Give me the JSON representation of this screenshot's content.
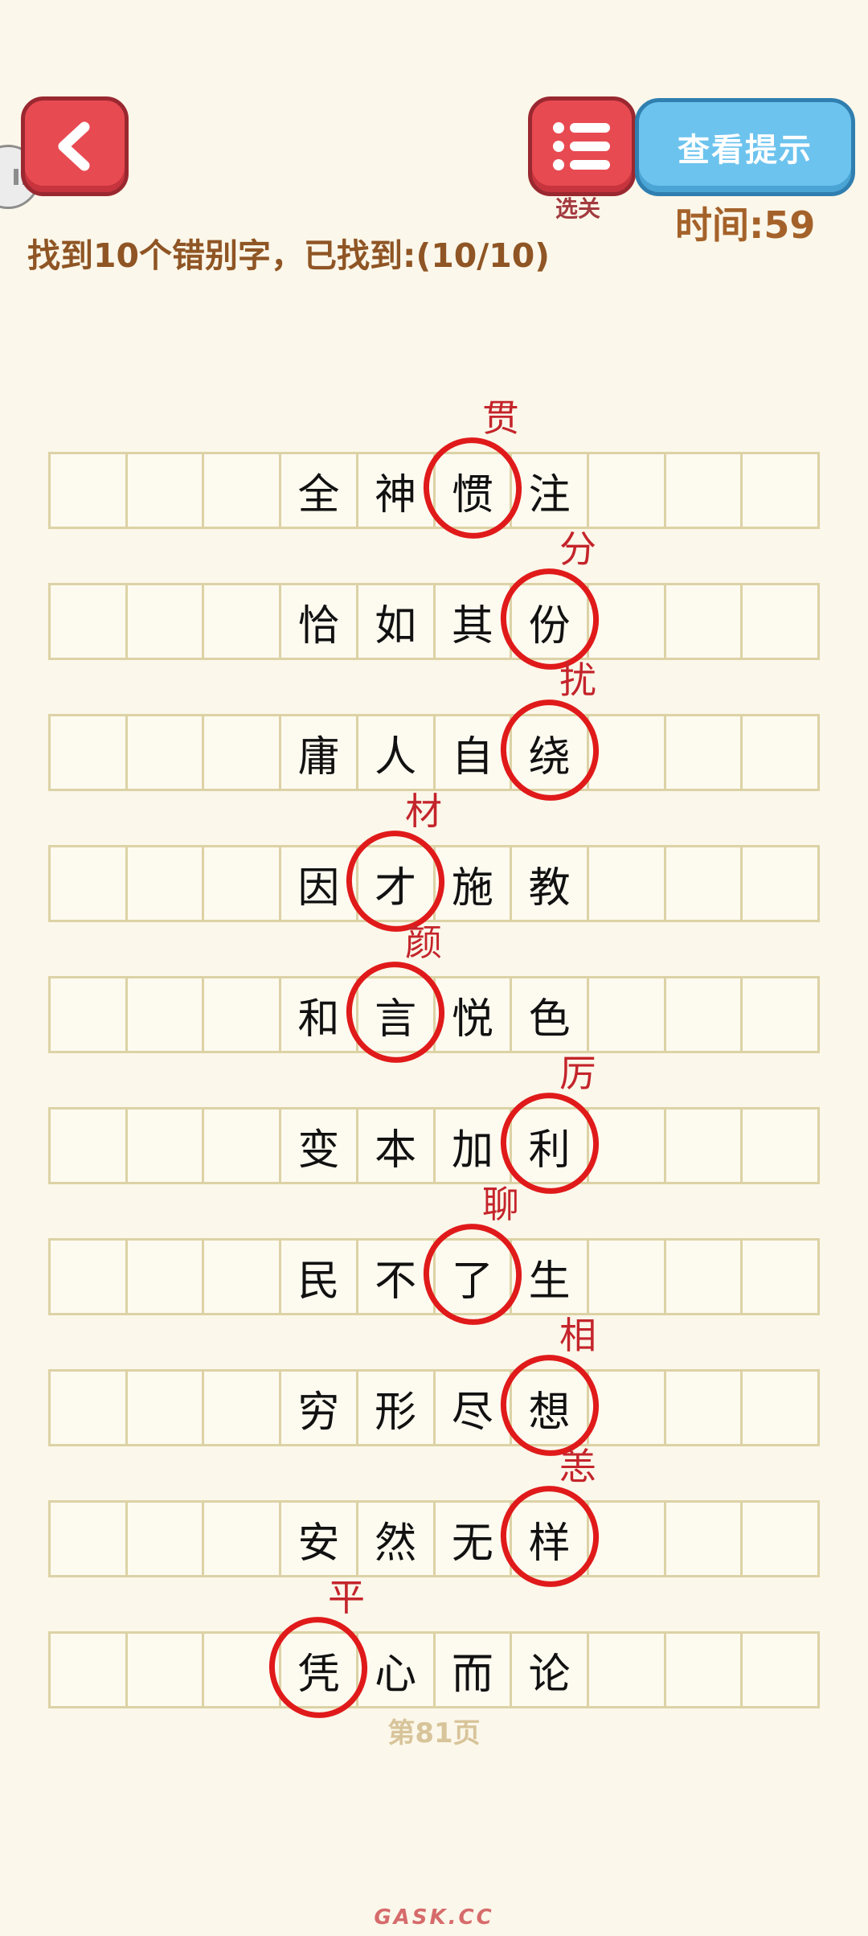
{
  "header": {
    "back_icon": "chevron-left-icon",
    "menu_icon": "list-icon",
    "menu_label": "选关",
    "hint_label": "查看提示",
    "timer": "时间:59",
    "status": "找到10个错别字，已找到:(10/10)"
  },
  "colors": {
    "mark": "#e01a1a",
    "correction": "#c4242b",
    "grid": "#dcd2a5",
    "background": "#fbf7ea"
  },
  "rows": [
    {
      "chars": [
        "",
        "",
        "",
        "全",
        "神",
        "惯",
        "注",
        "",
        "",
        ""
      ],
      "wrong_index": 5,
      "correction": "贯"
    },
    {
      "chars": [
        "",
        "",
        "",
        "恰",
        "如",
        "其",
        "份",
        "",
        "",
        ""
      ],
      "wrong_index": 6,
      "correction": "分"
    },
    {
      "chars": [
        "",
        "",
        "",
        "庸",
        "人",
        "自",
        "绕",
        "",
        "",
        ""
      ],
      "wrong_index": 6,
      "correction": "扰"
    },
    {
      "chars": [
        "",
        "",
        "",
        "因",
        "才",
        "施",
        "教",
        "",
        "",
        ""
      ],
      "wrong_index": 4,
      "correction": "材"
    },
    {
      "chars": [
        "",
        "",
        "",
        "和",
        "言",
        "悦",
        "色",
        "",
        "",
        ""
      ],
      "wrong_index": 4,
      "correction": "颜"
    },
    {
      "chars": [
        "",
        "",
        "",
        "变",
        "本",
        "加",
        "利",
        "",
        "",
        ""
      ],
      "wrong_index": 6,
      "correction": "厉"
    },
    {
      "chars": [
        "",
        "",
        "",
        "民",
        "不",
        "了",
        "生",
        "",
        "",
        ""
      ],
      "wrong_index": 5,
      "correction": "聊"
    },
    {
      "chars": [
        "",
        "",
        "",
        "穷",
        "形",
        "尽",
        "想",
        "",
        "",
        ""
      ],
      "wrong_index": 6,
      "correction": "相"
    },
    {
      "chars": [
        "",
        "",
        "",
        "安",
        "然",
        "无",
        "样",
        "",
        "",
        ""
      ],
      "wrong_index": 6,
      "correction": "恙"
    },
    {
      "chars": [
        "",
        "",
        "",
        "凭",
        "心",
        "而",
        "论",
        "",
        "",
        ""
      ],
      "wrong_index": 3,
      "correction": "平"
    }
  ],
  "page_number": "第81页",
  "watermark": "GASK.CC"
}
